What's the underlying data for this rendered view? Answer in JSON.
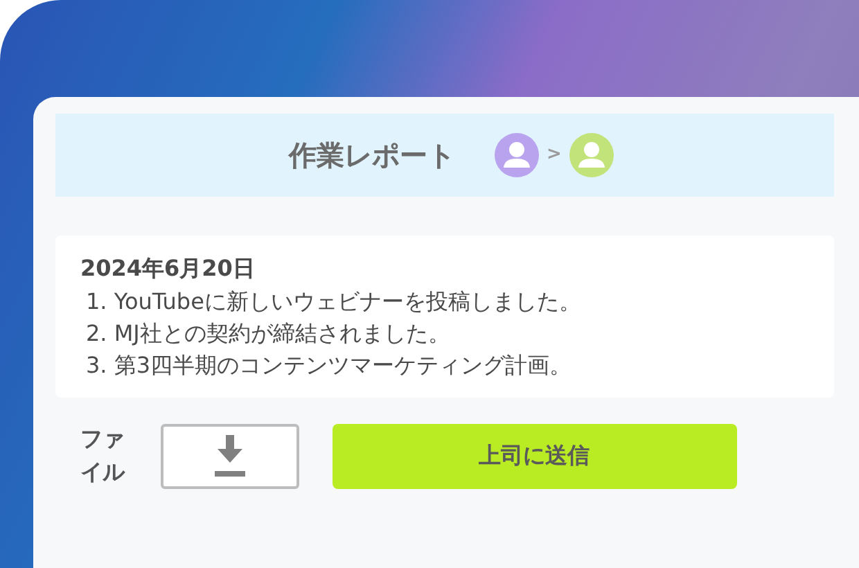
{
  "header": {
    "title": "作業レポート",
    "flow": [
      {
        "color": "#b9a3ee"
      },
      {
        "color": "#c2e27a"
      }
    ],
    "separator": ">"
  },
  "report": {
    "date": "2024年6月20日",
    "items": [
      "1. YouTubeに新しいウェビナーを投稿しました。",
      "2. MJ社との契約が締結されました。",
      "3. 第3四半期のコンテンツマーケティング計画。"
    ]
  },
  "file": {
    "label": "ファイル"
  },
  "submit": {
    "label": "上司に送信"
  }
}
